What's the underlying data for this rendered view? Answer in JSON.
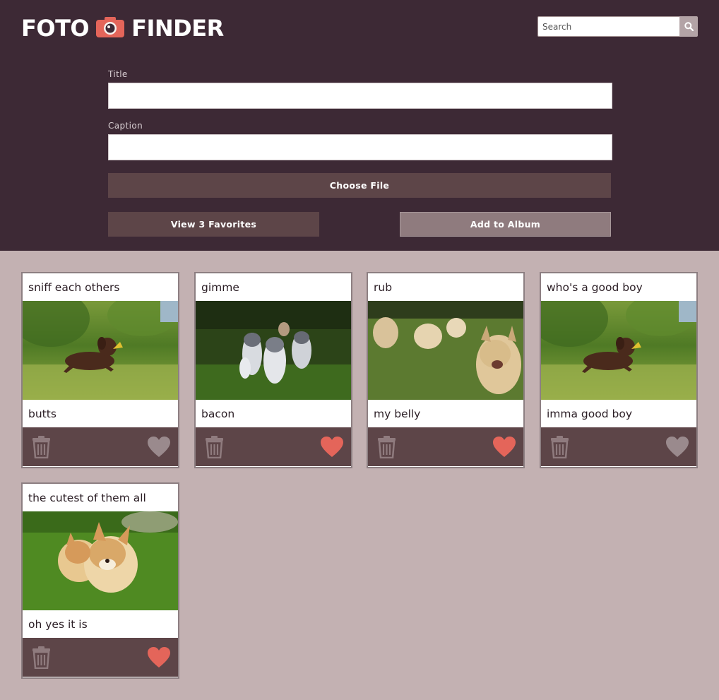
{
  "header": {
    "logo_left": "FOTO",
    "logo_right": "FINDER",
    "logo_icon": "camera-icon",
    "search": {
      "placeholder": "Search",
      "value": "",
      "icon": "search-icon"
    }
  },
  "form": {
    "title_label": "Title",
    "title_value": "",
    "caption_label": "Caption",
    "caption_value": "",
    "choose_file_label": "Choose File",
    "view_favorites_label": "View 3 Favorites",
    "add_album_label": "Add to Album"
  },
  "colors": {
    "header_bg": "#3d2935",
    "page_bg": "#c3b1b2",
    "button_dark": "#5d4548",
    "button_light": "#8f7b7e",
    "accent_heart": "#e4655a",
    "heart_inactive": "#9a8a8d"
  },
  "cards": [
    {
      "title": "sniff each others",
      "caption": "butts",
      "photo": "chocolate-lab-puppy",
      "favorited": false
    },
    {
      "title": "gimme",
      "caption": "bacon",
      "photo": "husky-puppies",
      "favorited": true
    },
    {
      "title": "rub",
      "caption": "my belly",
      "photo": "golden-puppies",
      "favorited": true
    },
    {
      "title": "who's a good boy",
      "caption": "imma good boy",
      "photo": "chocolate-lab-puppy",
      "favorited": false
    },
    {
      "title": "the cutest of them all",
      "caption": "oh yes it is",
      "photo": "corgi-puppies",
      "favorited": true
    }
  ]
}
